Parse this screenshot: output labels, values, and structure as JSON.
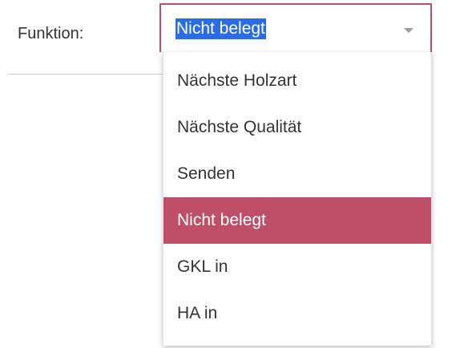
{
  "field": {
    "label": "Funktion:"
  },
  "select": {
    "value": "Nicht belegt",
    "caret_icon": "caret-down-icon",
    "border_color": "#c04d6a",
    "highlight_color": "#2a6ce3"
  },
  "dropdown": {
    "selected_index": 3,
    "selected_color": "#bf4f69",
    "options": [
      {
        "label": "Nächste Holzart"
      },
      {
        "label": "Nächste Qualität"
      },
      {
        "label": "Senden"
      },
      {
        "label": "Nicht belegt"
      },
      {
        "label": "GKL in"
      },
      {
        "label": "HA in"
      }
    ]
  }
}
